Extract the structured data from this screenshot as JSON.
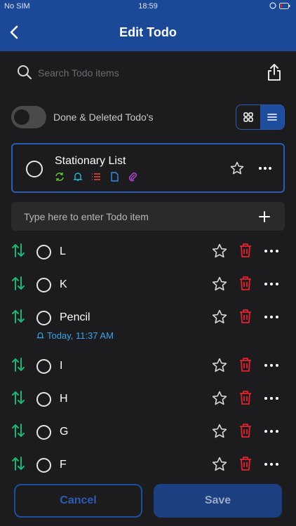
{
  "status_bar": {
    "carrier": "No SIM",
    "time": "18:59"
  },
  "header": {
    "title": "Edit Todo"
  },
  "search": {
    "placeholder": "Search Todo items"
  },
  "filter": {
    "toggle_label": "Done & Deleted Todo's",
    "toggle_on": false,
    "view_mode": "list"
  },
  "list": {
    "name": "Stationary List",
    "badges": [
      "repeat-icon",
      "bell-icon",
      "list-icon",
      "note-icon",
      "attachment-icon"
    ]
  },
  "add_item": {
    "placeholder": "Type here to enter Todo item"
  },
  "todos": [
    {
      "label": "L"
    },
    {
      "label": "K"
    },
    {
      "label": "Pencil",
      "reminder": "Today, 11:37 AM"
    },
    {
      "label": "I"
    },
    {
      "label": "H"
    },
    {
      "label": "G"
    },
    {
      "label": "F"
    }
  ],
  "footer": {
    "cancel_label": "Cancel",
    "save_label": "Save"
  },
  "colors": {
    "header": "#1b4897",
    "accent": "#2b5cb5",
    "reorder": "#1db574",
    "trash": "#e5212e",
    "reminder": "#3aa3e8"
  }
}
